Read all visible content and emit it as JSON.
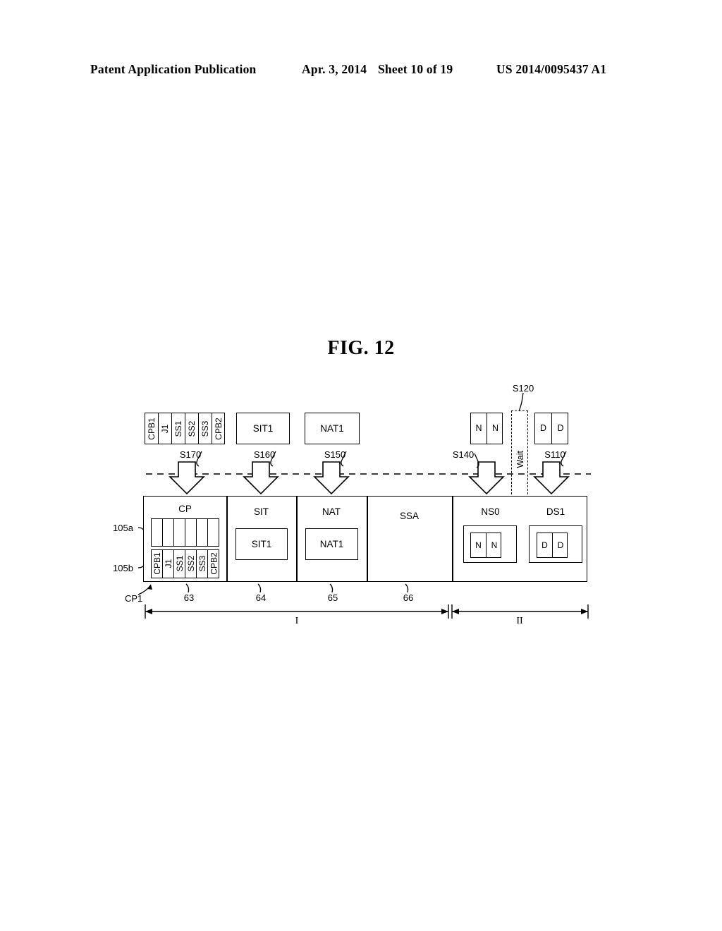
{
  "header": {
    "publication": "Patent Application Publication",
    "date": "Apr. 3, 2014",
    "sheet": "Sheet 10 of 19",
    "patent_number": "US 2014/0095437 A1"
  },
  "figure": {
    "title": "FIG. 12"
  },
  "top_row": {
    "packet": {
      "segments": [
        "CPB1",
        "J1",
        "SS1",
        "SS2",
        "SS3",
        "CPB2"
      ],
      "step": "S170"
    },
    "sit_box": {
      "label": "SIT1",
      "step": "S160"
    },
    "nat_box": {
      "label": "NAT1",
      "step": "S150"
    },
    "n_box": {
      "cells": [
        "N",
        "N"
      ],
      "step": "S140"
    },
    "wait_column": {
      "label": "Wait",
      "step": "S120"
    },
    "d_box": {
      "cells": [
        "D",
        "D"
      ],
      "step": "S110"
    }
  },
  "main_row": {
    "cells": [
      {
        "title": "CP",
        "ref": "63",
        "row_upper_label": "105a",
        "row_lower_label": "105b",
        "pointer_label": "CP1",
        "segments_upper": [
          "",
          "",
          "",
          "",
          "",
          ""
        ],
        "segments_lower": [
          "CPB1",
          "J1",
          "SS1",
          "SS2",
          "SS3",
          "CPB2"
        ]
      },
      {
        "title": "SIT",
        "ref": "64",
        "inner": "SIT1"
      },
      {
        "title": "NAT",
        "ref": "65",
        "inner": "NAT1"
      },
      {
        "title": "SSA",
        "ref": "66",
        "inner": ""
      }
    ],
    "region_two": {
      "ns_group": {
        "title": "NS0",
        "cells": [
          "N",
          "N"
        ]
      },
      "ds_group": {
        "title": "DS1",
        "cells": [
          "D",
          "D"
        ]
      }
    }
  },
  "spans": [
    {
      "label": "I"
    },
    {
      "label": "II"
    }
  ]
}
